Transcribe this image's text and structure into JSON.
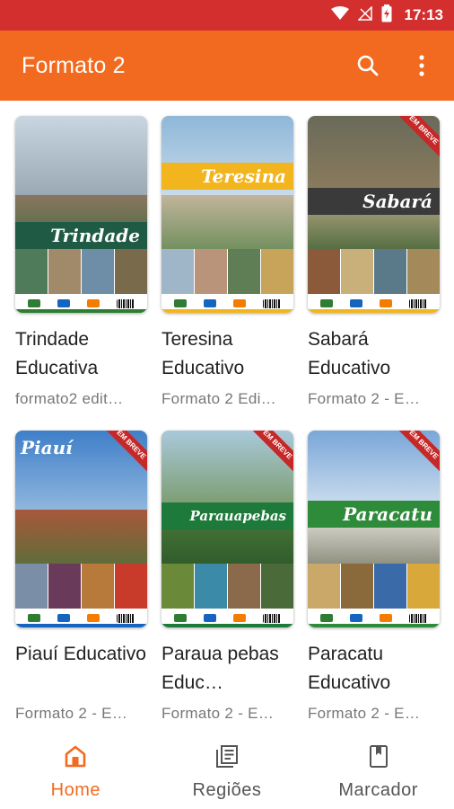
{
  "status_bar": {
    "time": "17:13"
  },
  "app_bar": {
    "title": "Formato 2",
    "search_icon": "search-icon",
    "more_icon": "more-vert-icon"
  },
  "colors": {
    "status_bar": "#d32f2f",
    "app_bar": "#f26a1f",
    "accent": "#f26a1f"
  },
  "books": [
    {
      "cover_title": "Trindade",
      "name": "Trindade Educativa",
      "subtitle": "formato2 edit…",
      "ribbon": ""
    },
    {
      "cover_title": "Teresina",
      "name": "Teresina Educativo",
      "subtitle": "Formato 2 Edi…",
      "ribbon": ""
    },
    {
      "cover_title": "Sabará",
      "name": "Sabará Educativo",
      "subtitle": "Formato 2 - E…",
      "ribbon": "EM BREVE"
    },
    {
      "cover_title": "Piauí",
      "name": "Piauí Educativo",
      "subtitle": "Formato 2 - E…",
      "ribbon": "EM BREVE"
    },
    {
      "cover_title": "Parauapebas",
      "name": "Paraua pebas Educ…",
      "subtitle": "Formato 2 - E…",
      "ribbon": "EM BREVE"
    },
    {
      "cover_title": "Paracatu",
      "name": "Paracatu Educativo",
      "subtitle": "Formato 2 - E…",
      "ribbon": "EM BREVE"
    }
  ],
  "bottom_nav": {
    "home": "Home",
    "regioes": "Regiões",
    "marcador": "Marcador"
  }
}
